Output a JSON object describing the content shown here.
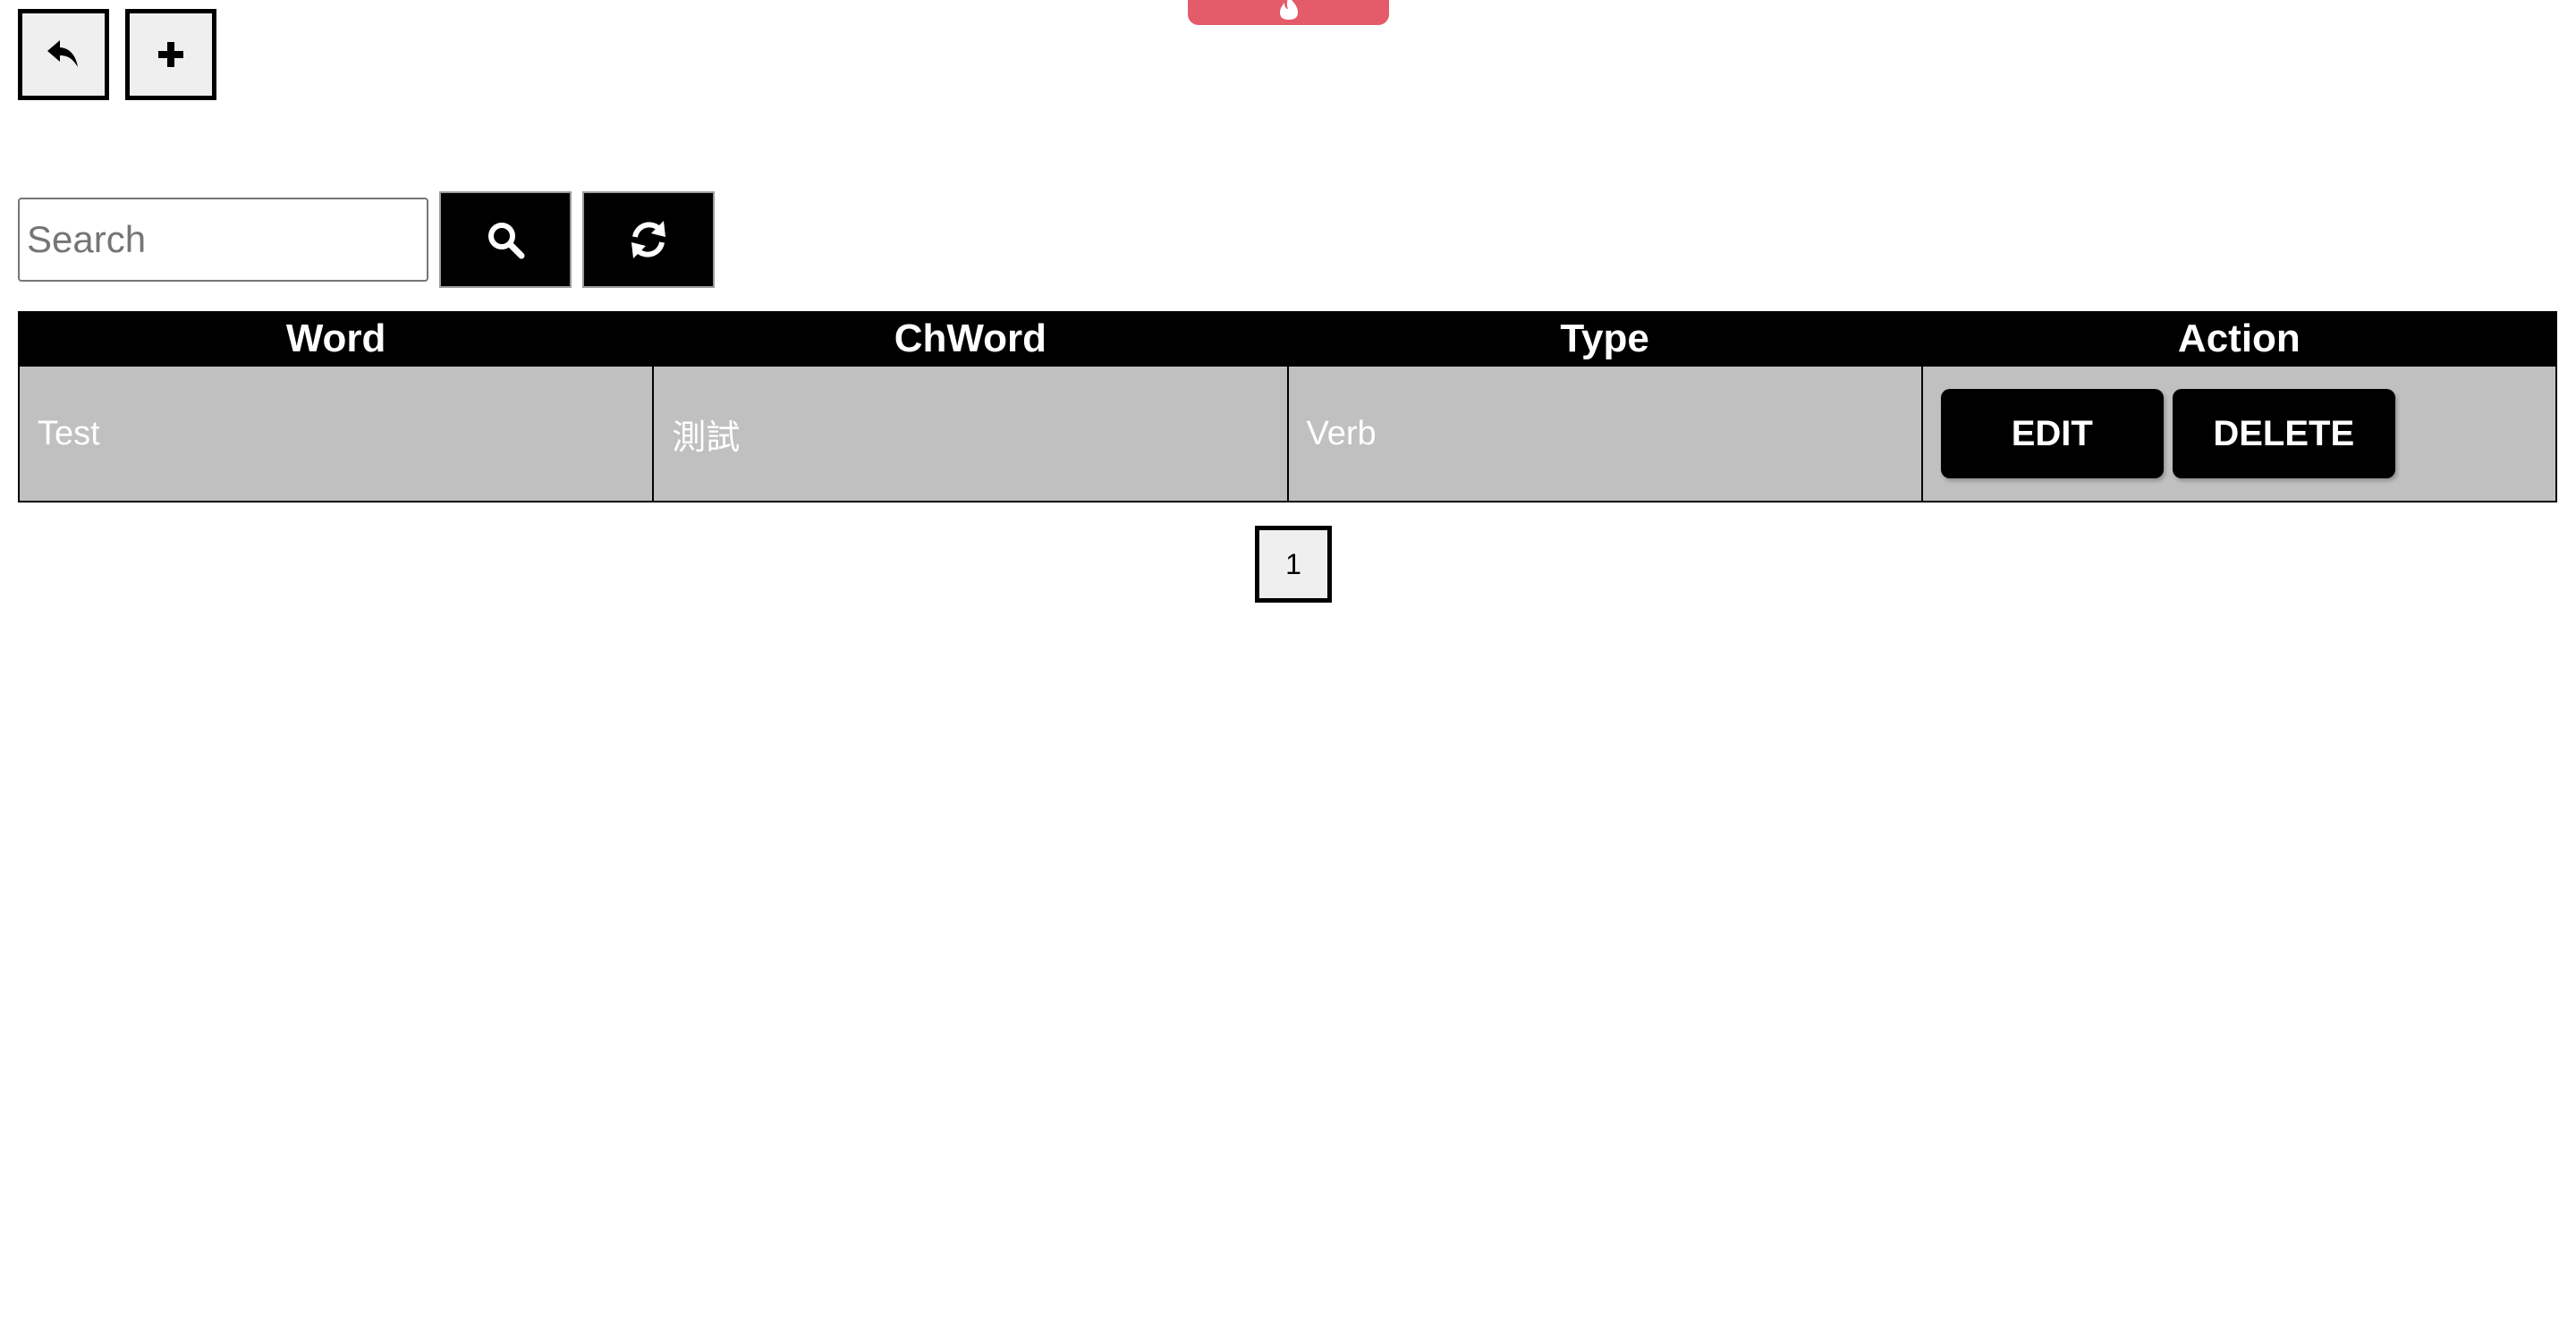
{
  "devtools_tab": {
    "icon": "flame-icon",
    "color": "#e45b6a"
  },
  "toolbar": {
    "back_icon": "reply-arrow-icon",
    "add_icon": "plus-icon"
  },
  "search": {
    "placeholder": "Search",
    "value": "",
    "search_icon": "search-icon",
    "refresh_icon": "refresh-icon"
  },
  "table": {
    "columns": [
      "Word",
      "ChWord",
      "Type",
      "Action"
    ],
    "rows": [
      {
        "word": "Test",
        "chword": "測試",
        "type": "Verb",
        "edit_label": "EDIT",
        "delete_label": "DELETE"
      }
    ]
  },
  "pagination": {
    "current_page": "1"
  }
}
